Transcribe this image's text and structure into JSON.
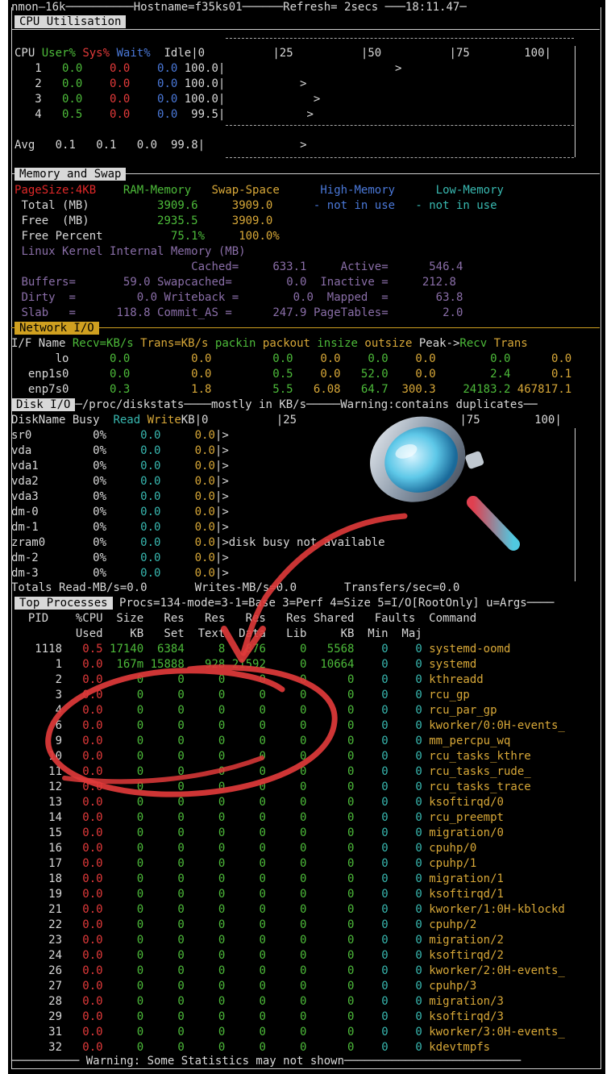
{
  "title_bar": {
    "app": "nmon—16k",
    "hostname": "Hostname=f35ks01",
    "refresh": "Refresh= 2secs",
    "time": "18:11.47"
  },
  "cpu": {
    "header": "CPU Utilisation",
    "columns": [
      "CPU",
      "User%",
      "Sys%",
      "Wait%",
      "Idle"
    ],
    "scale": "|0          |25          |50          |75        100|",
    "rows": [
      {
        "cpu": "1",
        "user": "0.0",
        "sys": "0.0",
        "wait": "0.0",
        "idle": "100.0"
      },
      {
        "cpu": "2",
        "user": "0.0",
        "sys": "0.0",
        "wait": "0.0",
        "idle": "100.0"
      },
      {
        "cpu": "3",
        "user": "0.0",
        "sys": "0.0",
        "wait": "0.0",
        "idle": "100.0"
      },
      {
        "cpu": "4",
        "user": "0.5",
        "sys": "0.0",
        "wait": "0.0",
        "idle": "99.5"
      }
    ],
    "avg": {
      "label": "Avg",
      "user": "0.1",
      "sys": "0.1",
      "wait": "0.0",
      "idle": "99.8"
    },
    "marker": ">"
  },
  "memory": {
    "header": "Memory and Swap",
    "pagesize": "PageSize:4KB",
    "ram": "RAM-Memory",
    "swap": "Swap-Space",
    "high": "High-Memory",
    "low": "Low-Memory",
    "total_label": "Total (MB)",
    "total_ram": "3909.6",
    "total_swap": "3909.0",
    "not_in_use": "- not in use",
    "free_label": "Free  (MB)",
    "free_ram": "2935.5",
    "free_swap": "3909.0",
    "freepct_label": "Free Percent",
    "freepct_ram": "75.1%",
    "freepct_swap": "100.0%",
    "kernel_label": "Linux Kernel Internal Memory (MB)",
    "cached": "Cached=",
    "cached_v": "633.1",
    "active": "Active=",
    "active_v": "546.4",
    "buffers": "Buffers=",
    "buffers_v": "59.0",
    "swapcached": "Swapcached=",
    "swapcached_v": "0.0",
    "inactive": "Inactive =",
    "inactive_v": "212.8",
    "dirty": "Dirty  =",
    "dirty_v": "0.0",
    "writeback": "Writeback =",
    "writeback_v": "0.0",
    "mapped": "Mapped  =",
    "mapped_v": "63.8",
    "slab": "Slab   =",
    "slab_v": "118.8",
    "commit": "Commit_AS =",
    "commit_v": "247.9",
    "pagetables": "PageTables=",
    "pagetables_v": "2.0"
  },
  "network": {
    "header": "Network I/O",
    "cols": [
      "I/F Name",
      "Recv=KB/s",
      "Trans=KB/s",
      "packin",
      "packout",
      "insize",
      "outsize",
      "Peak->",
      "Recv",
      "Trans"
    ],
    "rows": [
      {
        "name": "lo",
        "recv": "0.0",
        "trans": "0.0",
        "packin": "0.0",
        "packout": "0.0",
        "insize": "0.0",
        "outsize": "0.0",
        "peak_recv": "0.0",
        "peak_trans": "0.0"
      },
      {
        "name": "enp1s0",
        "recv": "0.0",
        "trans": "0.0",
        "packin": "0.5",
        "packout": "0.0",
        "insize": "52.0",
        "outsize": "0.0",
        "peak_recv": "2.4",
        "peak_trans": "0.1"
      },
      {
        "name": "enp7s0",
        "recv": "0.3",
        "trans": "1.8",
        "packin": "5.5",
        "packout": "6.08",
        "insize": "64.7",
        "outsize": "300.3",
        "peak_recv": "24183.2",
        "peak_trans": "467817.1"
      }
    ]
  },
  "disk": {
    "header": "Disk I/O",
    "path": "/proc/diskstats",
    "units": "mostly in KB/s",
    "warning": "Warning:contains duplicates",
    "cols": [
      "DiskName",
      "Busy",
      "Read",
      "Write",
      "KB"
    ],
    "scale": "|0          |25",
    "scale_end": "|75        100|",
    "rows": [
      {
        "name": "sr0",
        "busy": "0%",
        "read": "0.0",
        "write": "0.0",
        "bar": ">"
      },
      {
        "name": "vda",
        "busy": "0%",
        "read": "0.0",
        "write": "0.0",
        "bar": ">"
      },
      {
        "name": "vda1",
        "busy": "0%",
        "read": "0.0",
        "write": "0.0",
        "bar": ">"
      },
      {
        "name": "vda2",
        "busy": "0%",
        "read": "0.0",
        "write": "0.0",
        "bar": ">"
      },
      {
        "name": "vda3",
        "busy": "0%",
        "read": "0.0",
        "write": "0.0",
        "bar": ">"
      },
      {
        "name": "dm-0",
        "busy": "0%",
        "read": "0.0",
        "write": "0.0",
        "bar": ">"
      },
      {
        "name": "dm-1",
        "busy": "0%",
        "read": "0.0",
        "write": "0.0",
        "bar": ">"
      },
      {
        "name": "zram0",
        "busy": "0%",
        "read": "0.0",
        "write": "0.0",
        "bar": ">disk busy not available"
      },
      {
        "name": "dm-2",
        "busy": "0%",
        "read": "0.0",
        "write": "0.0",
        "bar": ">"
      },
      {
        "name": "dm-3",
        "busy": "0%",
        "read": "0.0",
        "write": "0.0",
        "bar": ">"
      }
    ],
    "totals_read": "Totals Read-MB/s=0.0",
    "totals_write": "Writes-MB/s=0.0",
    "totals_transfers": "Transfers/sec=0.0"
  },
  "processes": {
    "header": "Top Processes",
    "modes": "Procs=134-mode=3-1=Base 3=Perf 4=Size 5=I/O[RootOnly] u=Args",
    "head1": "  PID    %CPU  Size   Res   Res   Res   Res Shared   Faults  Command",
    "head2": "         Used    KB   Set  Text  Data   Lib     KB  Min  Maj",
    "rows": [
      {
        "pid": "1118",
        "cpu": "0.5",
        "size": "17140",
        "res": "6384",
        "text": "8",
        "data": "876",
        "lib": "0",
        "shared": "5568",
        "min": "0",
        "maj": "0",
        "cmd": "systemd-oomd"
      },
      {
        "pid": "1",
        "cpu": "0.0",
        "size": "167m",
        "res": "15888",
        "text": "928",
        "data": "21592",
        "lib": "0",
        "shared": "10664",
        "min": "0",
        "maj": "0",
        "cmd": "systemd"
      },
      {
        "pid": "2",
        "cpu": "0.0",
        "size": "0",
        "res": "0",
        "text": "0",
        "data": "0",
        "lib": "0",
        "shared": "0",
        "min": "0",
        "maj": "0",
        "cmd": "kthreadd"
      },
      {
        "pid": "3",
        "cpu": "0.0",
        "size": "0",
        "res": "0",
        "text": "0",
        "data": "0",
        "lib": "0",
        "shared": "0",
        "min": "0",
        "maj": "0",
        "cmd": "rcu_gp"
      },
      {
        "pid": "4",
        "cpu": "0.0",
        "size": "0",
        "res": "0",
        "text": "0",
        "data": "0",
        "lib": "0",
        "shared": "0",
        "min": "0",
        "maj": "0",
        "cmd": "rcu_par_gp"
      },
      {
        "pid": "6",
        "cpu": "0.0",
        "size": "0",
        "res": "0",
        "text": "0",
        "data": "0",
        "lib": "0",
        "shared": "0",
        "min": "0",
        "maj": "0",
        "cmd": "kworker/0:0H-events_"
      },
      {
        "pid": "9",
        "cpu": "0.0",
        "size": "0",
        "res": "0",
        "text": "0",
        "data": "0",
        "lib": "0",
        "shared": "0",
        "min": "0",
        "maj": "0",
        "cmd": "mm_percpu_wq"
      },
      {
        "pid": "10",
        "cpu": "0.0",
        "size": "0",
        "res": "0",
        "text": "0",
        "data": "0",
        "lib": "0",
        "shared": "0",
        "min": "0",
        "maj": "0",
        "cmd": "rcu_tasks_kthre"
      },
      {
        "pid": "11",
        "cpu": "0.0",
        "size": "0",
        "res": "0",
        "text": "0",
        "data": "0",
        "lib": "0",
        "shared": "0",
        "min": "0",
        "maj": "0",
        "cmd": "rcu_tasks_rude_"
      },
      {
        "pid": "12",
        "cpu": "0.0",
        "size": "0",
        "res": "0",
        "text": "0",
        "data": "0",
        "lib": "0",
        "shared": "0",
        "min": "0",
        "maj": "0",
        "cmd": "rcu_tasks_trace"
      },
      {
        "pid": "13",
        "cpu": "0.0",
        "size": "0",
        "res": "0",
        "text": "0",
        "data": "0",
        "lib": "0",
        "shared": "0",
        "min": "0",
        "maj": "0",
        "cmd": "ksoftirqd/0"
      },
      {
        "pid": "14",
        "cpu": "0.0",
        "size": "0",
        "res": "0",
        "text": "0",
        "data": "0",
        "lib": "0",
        "shared": "0",
        "min": "0",
        "maj": "0",
        "cmd": "rcu_preempt"
      },
      {
        "pid": "15",
        "cpu": "0.0",
        "size": "0",
        "res": "0",
        "text": "0",
        "data": "0",
        "lib": "0",
        "shared": "0",
        "min": "0",
        "maj": "0",
        "cmd": "migration/0"
      },
      {
        "pid": "16",
        "cpu": "0.0",
        "size": "0",
        "res": "0",
        "text": "0",
        "data": "0",
        "lib": "0",
        "shared": "0",
        "min": "0",
        "maj": "0",
        "cmd": "cpuhp/0"
      },
      {
        "pid": "17",
        "cpu": "0.0",
        "size": "0",
        "res": "0",
        "text": "0",
        "data": "0",
        "lib": "0",
        "shared": "0",
        "min": "0",
        "maj": "0",
        "cmd": "cpuhp/1"
      },
      {
        "pid": "18",
        "cpu": "0.0",
        "size": "0",
        "res": "0",
        "text": "0",
        "data": "0",
        "lib": "0",
        "shared": "0",
        "min": "0",
        "maj": "0",
        "cmd": "migration/1"
      },
      {
        "pid": "19",
        "cpu": "0.0",
        "size": "0",
        "res": "0",
        "text": "0",
        "data": "0",
        "lib": "0",
        "shared": "0",
        "min": "0",
        "maj": "0",
        "cmd": "ksoftirqd/1"
      },
      {
        "pid": "21",
        "cpu": "0.0",
        "size": "0",
        "res": "0",
        "text": "0",
        "data": "0",
        "lib": "0",
        "shared": "0",
        "min": "0",
        "maj": "0",
        "cmd": "kworker/1:0H-kblockd"
      },
      {
        "pid": "22",
        "cpu": "0.0",
        "size": "0",
        "res": "0",
        "text": "0",
        "data": "0",
        "lib": "0",
        "shared": "0",
        "min": "0",
        "maj": "0",
        "cmd": "cpuhp/2"
      },
      {
        "pid": "23",
        "cpu": "0.0",
        "size": "0",
        "res": "0",
        "text": "0",
        "data": "0",
        "lib": "0",
        "shared": "0",
        "min": "0",
        "maj": "0",
        "cmd": "migration/2"
      },
      {
        "pid": "24",
        "cpu": "0.0",
        "size": "0",
        "res": "0",
        "text": "0",
        "data": "0",
        "lib": "0",
        "shared": "0",
        "min": "0",
        "maj": "0",
        "cmd": "ksoftirqd/2"
      },
      {
        "pid": "26",
        "cpu": "0.0",
        "size": "0",
        "res": "0",
        "text": "0",
        "data": "0",
        "lib": "0",
        "shared": "0",
        "min": "0",
        "maj": "0",
        "cmd": "kworker/2:0H-events_"
      },
      {
        "pid": "27",
        "cpu": "0.0",
        "size": "0",
        "res": "0",
        "text": "0",
        "data": "0",
        "lib": "0",
        "shared": "0",
        "min": "0",
        "maj": "0",
        "cmd": "cpuhp/3"
      },
      {
        "pid": "28",
        "cpu": "0.0",
        "size": "0",
        "res": "0",
        "text": "0",
        "data": "0",
        "lib": "0",
        "shared": "0",
        "min": "0",
        "maj": "0",
        "cmd": "migration/3"
      },
      {
        "pid": "29",
        "cpu": "0.0",
        "size": "0",
        "res": "0",
        "text": "0",
        "data": "0",
        "lib": "0",
        "shared": "0",
        "min": "0",
        "maj": "0",
        "cmd": "ksoftirqd/3"
      },
      {
        "pid": "31",
        "cpu": "0.0",
        "size": "0",
        "res": "0",
        "text": "0",
        "data": "0",
        "lib": "0",
        "shared": "0",
        "min": "0",
        "maj": "0",
        "cmd": "kworker/3:0H-events_"
      },
      {
        "pid": "32",
        "cpu": "0.0",
        "size": "0",
        "res": "0",
        "text": "0",
        "data": "0",
        "lib": "0",
        "shared": "0",
        "min": "0",
        "maj": "0",
        "cmd": "kdevtmpfs"
      }
    ],
    "footer": "Warning: Some Statistics may not shown"
  },
  "colors": {
    "user": "#4dbb3a",
    "sys": "#e23a3a",
    "wait": "#4a78d8",
    "cmd": "#d8a838",
    "annotation": "#e03a3a"
  },
  "overlays": {
    "magnifier": "magnifier-icon",
    "arrow": "arrow-icon",
    "circle": "circle-mark"
  }
}
